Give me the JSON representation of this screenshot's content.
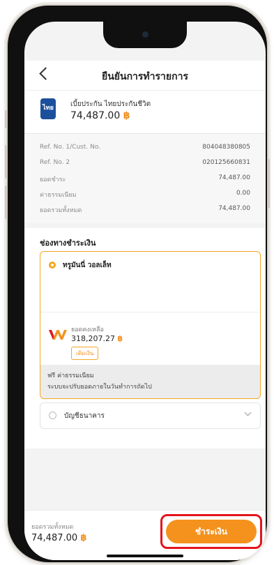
{
  "header": {
    "title": "ยืนยันการทำรายการ"
  },
  "biller": {
    "logo_text": "ไทย",
    "name": "เบี้ยประกัน ไทยประกันชีวิต",
    "amount": "74,487.00",
    "currency_symbol": "฿"
  },
  "details": [
    {
      "label": "Ref. No. 1/Cust. No.",
      "value": "804048380805"
    },
    {
      "label": "Ref. No. 2",
      "value": "020125660831"
    },
    {
      "label": "ยอดชำระ",
      "value": "74,487.00"
    },
    {
      "label": "ค่าธรรมเนียม",
      "value": "0.00"
    },
    {
      "label": "ยอดรวมทั้งหมด",
      "value": "74,487.00"
    }
  ],
  "payment_channel": {
    "title": "ช่องทางชำระเงิน",
    "wallet": {
      "name": "ทรูมันนี่ วอลเล็ท",
      "balance_label": "ยอดคงเหลือ",
      "balance": "318,207.27",
      "topup_label": "เติมเงิน",
      "fee_line1": "ฟรี ค่าธรรมเนียม",
      "fee_line2": "ระบบจะปรับยอดภายในวันทำการถัดไป"
    },
    "bank": {
      "name": "บัญชีธนาคาร"
    }
  },
  "footer": {
    "total_label": "ยอดรวมทั้งหมด",
    "total_value": "74,487.00",
    "pay_label": "ชำระเงิน"
  },
  "colors": {
    "accent": "#f5921e",
    "highlight": "#e3141c"
  }
}
